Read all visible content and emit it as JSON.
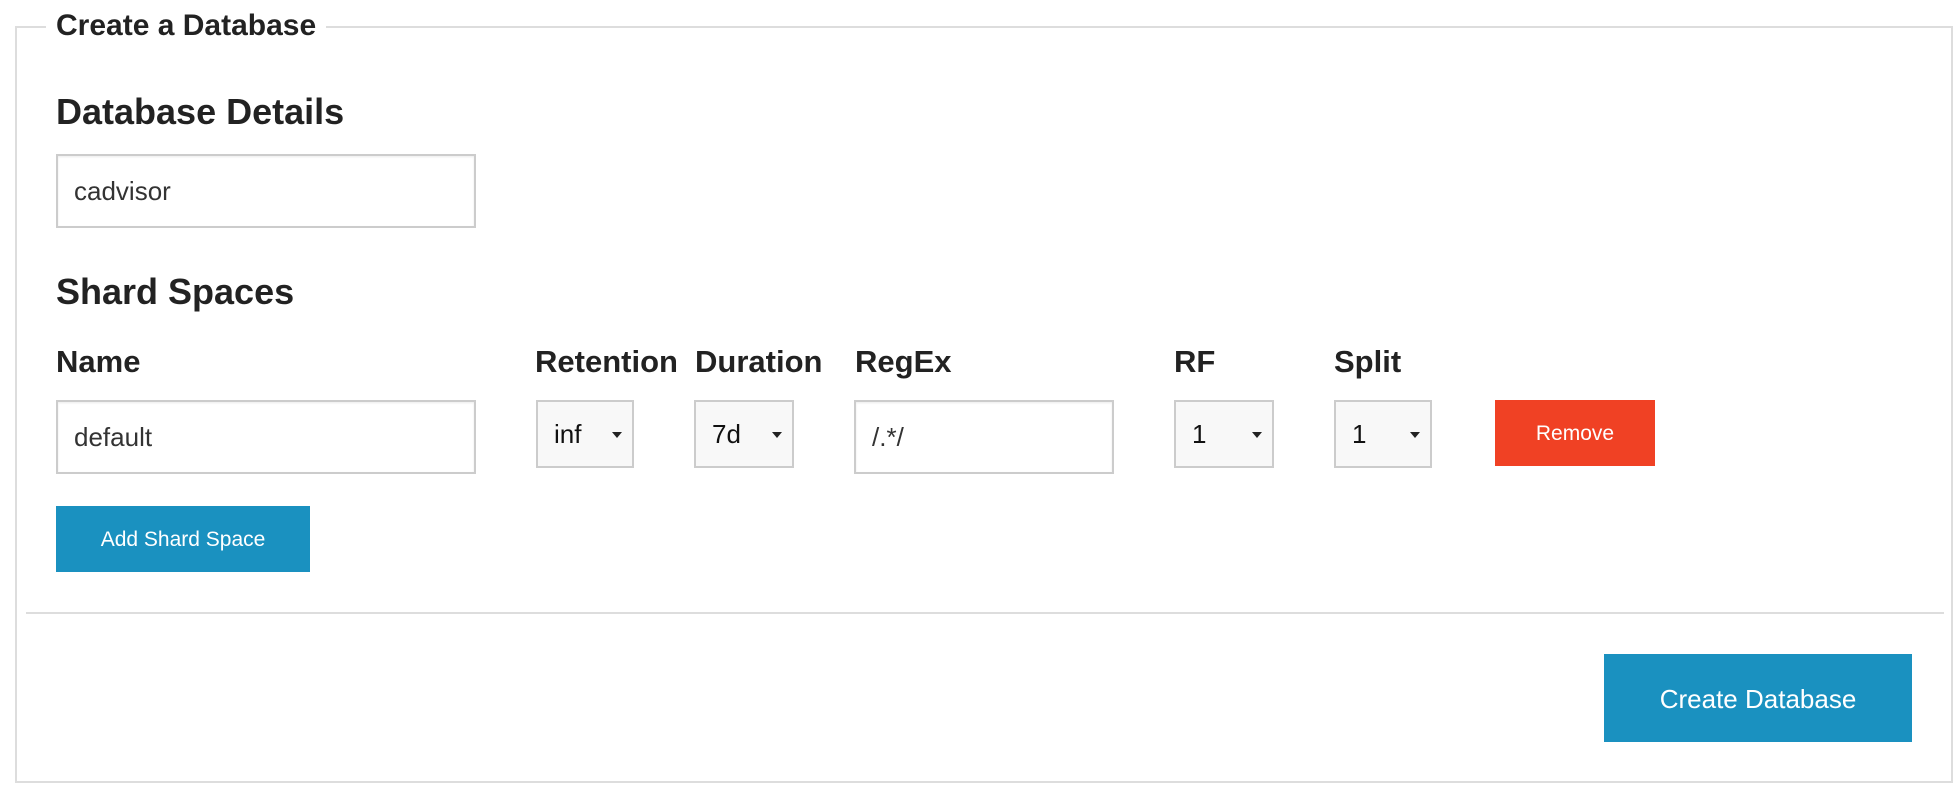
{
  "form": {
    "legend": "Create a Database"
  },
  "database_details": {
    "heading": "Database Details",
    "name_value": "cadvisor"
  },
  "shard_spaces": {
    "heading": "Shard Spaces",
    "columns": {
      "name": "Name",
      "retention": "Retention",
      "duration": "Duration",
      "regex": "RegEx",
      "rf": "RF",
      "split": "Split"
    },
    "rows": [
      {
        "name": "default",
        "retention": "inf",
        "duration": "7d",
        "regex": "/.*/",
        "rf": "1",
        "split": "1",
        "remove_label": "Remove"
      }
    ],
    "add_label": "Add Shard Space"
  },
  "footer": {
    "create_label": "Create Database"
  },
  "colors": {
    "primary": "#1a91c0",
    "danger": "#f04124",
    "border": "#dddddd"
  },
  "icons": {
    "select_caret": "caret-down-icon"
  }
}
